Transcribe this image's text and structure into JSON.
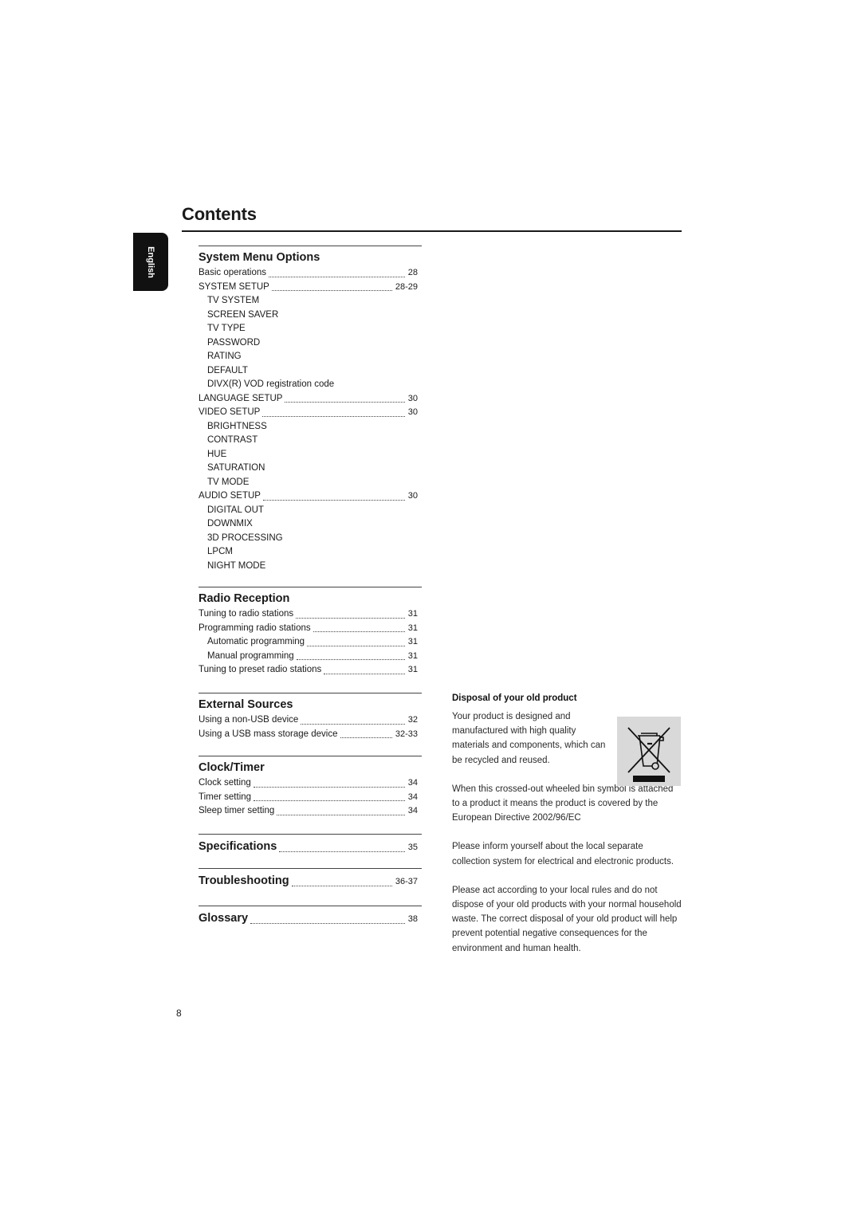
{
  "page": {
    "title": "Contents",
    "language_tab": "English",
    "page_number": "8"
  },
  "sections": {
    "system_menu": {
      "heading": "System Menu Options",
      "entries": [
        {
          "label": "Basic operations",
          "page": "28",
          "level": "main"
        },
        {
          "label": "SYSTEM SETUP",
          "page": "28-29",
          "level": "main"
        },
        {
          "label": "TV SYSTEM",
          "page": "",
          "level": "plain"
        },
        {
          "label": "SCREEN SAVER",
          "page": "",
          "level": "plain"
        },
        {
          "label": "TV TYPE",
          "page": "",
          "level": "plain"
        },
        {
          "label": "PASSWORD",
          "page": "",
          "level": "plain"
        },
        {
          "label": "RATING",
          "page": "",
          "level": "plain"
        },
        {
          "label": "DEFAULT",
          "page": "",
          "level": "plain"
        },
        {
          "label": "DIVX(R) VOD registration code",
          "page": "",
          "level": "plain"
        },
        {
          "label": "LANGUAGE SETUP",
          "page": "30",
          "level": "main"
        },
        {
          "label": "VIDEO SETUP",
          "page": "30",
          "level": "main"
        },
        {
          "label": "BRIGHTNESS",
          "page": "",
          "level": "plain"
        },
        {
          "label": "CONTRAST",
          "page": "",
          "level": "plain"
        },
        {
          "label": "HUE",
          "page": "",
          "level": "plain"
        },
        {
          "label": "SATURATION",
          "page": "",
          "level": "plain"
        },
        {
          "label": "TV MODE",
          "page": "",
          "level": "plain"
        },
        {
          "label": "AUDIO SETUP",
          "page": "30",
          "level": "main"
        },
        {
          "label": "DIGITAL OUT",
          "page": "",
          "level": "plain"
        },
        {
          "label": "DOWNMIX",
          "page": "",
          "level": "plain"
        },
        {
          "label": "3D PROCESSING",
          "page": "",
          "level": "plain"
        },
        {
          "label": "LPCM",
          "page": "",
          "level": "plain"
        },
        {
          "label": "NIGHT MODE",
          "page": "",
          "level": "plain"
        }
      ]
    },
    "radio": {
      "heading": "Radio Reception",
      "entries": [
        {
          "label": "Tuning to radio stations",
          "page": "31",
          "level": "main"
        },
        {
          "label": "Programming radio stations",
          "page": "31",
          "level": "main"
        },
        {
          "label": "Automatic programming",
          "page": "31",
          "level": "sub"
        },
        {
          "label": "Manual programming",
          "page": "31",
          "level": "sub"
        },
        {
          "label": "Tuning to preset radio stations",
          "page": "31",
          "level": "main"
        }
      ]
    },
    "external": {
      "heading": "External Sources",
      "entries": [
        {
          "label": "Using a non-USB device",
          "page": "32",
          "level": "main"
        },
        {
          "label": "Using a USB mass storage device",
          "page": "32-33",
          "level": "main"
        }
      ]
    },
    "clock": {
      "heading": "Clock/Timer",
      "entries": [
        {
          "label": "Clock setting",
          "page": "34",
          "level": "main"
        },
        {
          "label": "Timer setting",
          "page": "34",
          "level": "main"
        },
        {
          "label": "Sleep timer setting",
          "page": "34",
          "level": "main"
        }
      ]
    },
    "specifications": {
      "heading": "Specifications",
      "page": "35"
    },
    "troubleshooting": {
      "heading": "Troubleshooting",
      "page": "36-37"
    },
    "glossary": {
      "heading": "Glossary",
      "page": "38"
    }
  },
  "disposal": {
    "heading": "Disposal of  your old product",
    "paragraphs": [
      "Your product is designed and manufactured with high quality materials and components, which can be recycled and reused.",
      "When this crossed-out wheeled bin symbol is attached to a product it means the product is covered by the European Directive 2002/96/EC",
      "Please inform yourself about the local separate collection system for electrical and electronic products.",
      "Please act according to your local rules and do not dispose of your old products with your normal household waste. The correct disposal of your old product will help prevent potential negative consequences for the environment and human health."
    ],
    "icon": "crossed-out-wheeled-bin-icon"
  }
}
